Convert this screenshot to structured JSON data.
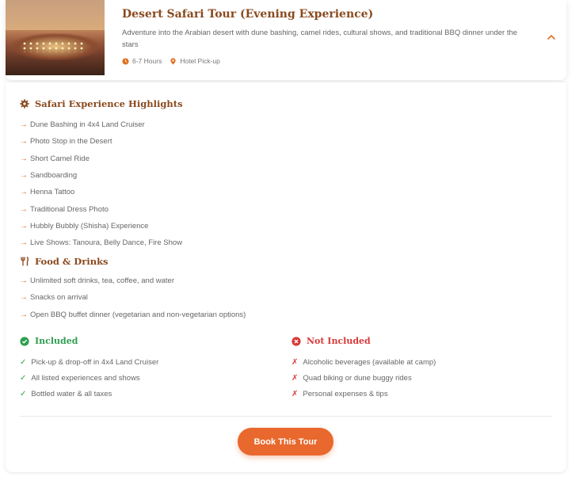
{
  "tour": {
    "title": "Desert Safari Tour (Evening Experience)",
    "description": "Adventure into the Arabian desert with dune bashing, camel rides, cultural shows, and traditional BBQ dinner under the stars",
    "duration": "6-7 Hours",
    "pickup": "Hotel Pick-up",
    "image_alt": "desert-camp-photo"
  },
  "highlights": {
    "heading": "Safari Experience Highlights",
    "items": [
      "Dune Bashing in 4x4 Land Cruiser",
      "Photo Stop in the Desert",
      "Short Camel Ride",
      "Sandboarding",
      "Henna Tattoo",
      "Traditional Dress Photo",
      "Hubbly Bubbly (Shisha) Experience",
      "Live Shows: Tanoura, Belly Dance, Fire Show"
    ]
  },
  "food": {
    "heading": "Food & Drinks",
    "items": [
      "Unlimited soft drinks, tea, coffee, and water",
      "Snacks on arrival",
      "Open BBQ buffet dinner (vegetarian and non-vegetarian options)"
    ]
  },
  "included": {
    "heading": "Included",
    "items": [
      "Pick-up & drop-off in 4x4 Land Cruiser",
      "All listed experiences and shows",
      "Bottled water & all taxes"
    ]
  },
  "not_included": {
    "heading": "Not Included",
    "items": [
      "Alcoholic beverages (available at camp)",
      "Quad biking or dune buggy rides",
      "Personal expenses & tips"
    ]
  },
  "actions": {
    "book_label": "Book This Tour"
  },
  "colors": {
    "brand": "#8a4a1e",
    "accent": "#e8682d",
    "success": "#2e9e4f",
    "danger": "#d83a3a"
  },
  "icons": {
    "duration": "clock-icon",
    "pickup": "location-pin-icon",
    "collapse": "chevron-up-icon",
    "highlights": "gear-icon",
    "food": "utensils-icon",
    "included": "check-circle-icon",
    "not_included": "x-circle-icon"
  }
}
